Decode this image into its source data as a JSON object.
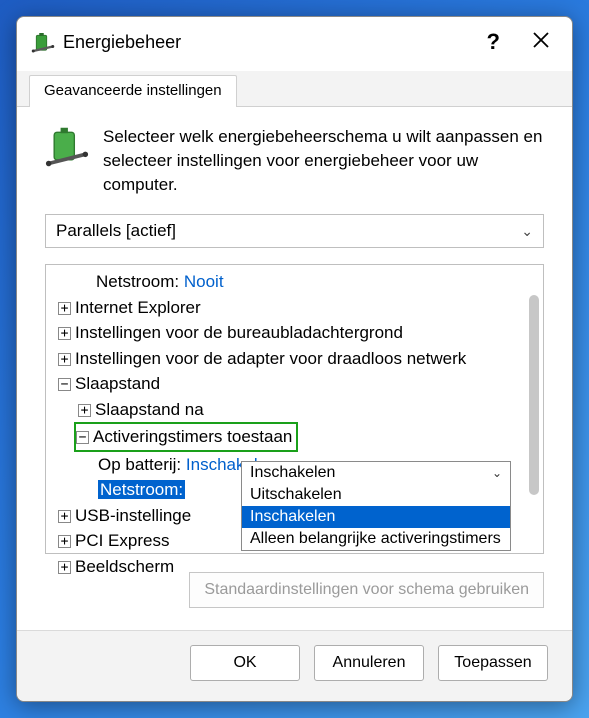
{
  "title": "Energiebeheer",
  "tab": "Geavanceerde instellingen",
  "intro": "Selecteer welk energiebeheerschema u wilt aanpassen en selecteer instellingen voor energiebeheer voor uw computer.",
  "scheme": "Parallels [actief]",
  "tree": {
    "netstroom_lbl": "Netstroom:",
    "netstroom_val": "Nooit",
    "ie": "Internet Explorer",
    "bg": "Instellingen voor de bureaubladachtergrond",
    "wifi": "Instellingen voor de adapter voor draadloos netwerk",
    "sleep": "Slaapstand",
    "sleep_after": "Slaapstand na",
    "wake_timers": "Activeringstimers toestaan",
    "wake_batt_lbl": "Op batterij:",
    "wake_batt_val": "Inschakelen",
    "wake_ac_lbl": "Netstroom:",
    "wake_ac_val": "Inschakelen",
    "usb": "USB-instellinge",
    "pci": "PCI Express",
    "display": "Beeldscherm"
  },
  "combo": {
    "selected": "Inschakelen",
    "opt1": "Uitschakelen",
    "opt2": "Inschakelen",
    "opt3": "Alleen belangrijke activeringstimers"
  },
  "buttons": {
    "restore": "Standaardinstellingen voor schema gebruiken",
    "ok": "OK",
    "cancel": "Annuleren",
    "apply": "Toepassen"
  }
}
